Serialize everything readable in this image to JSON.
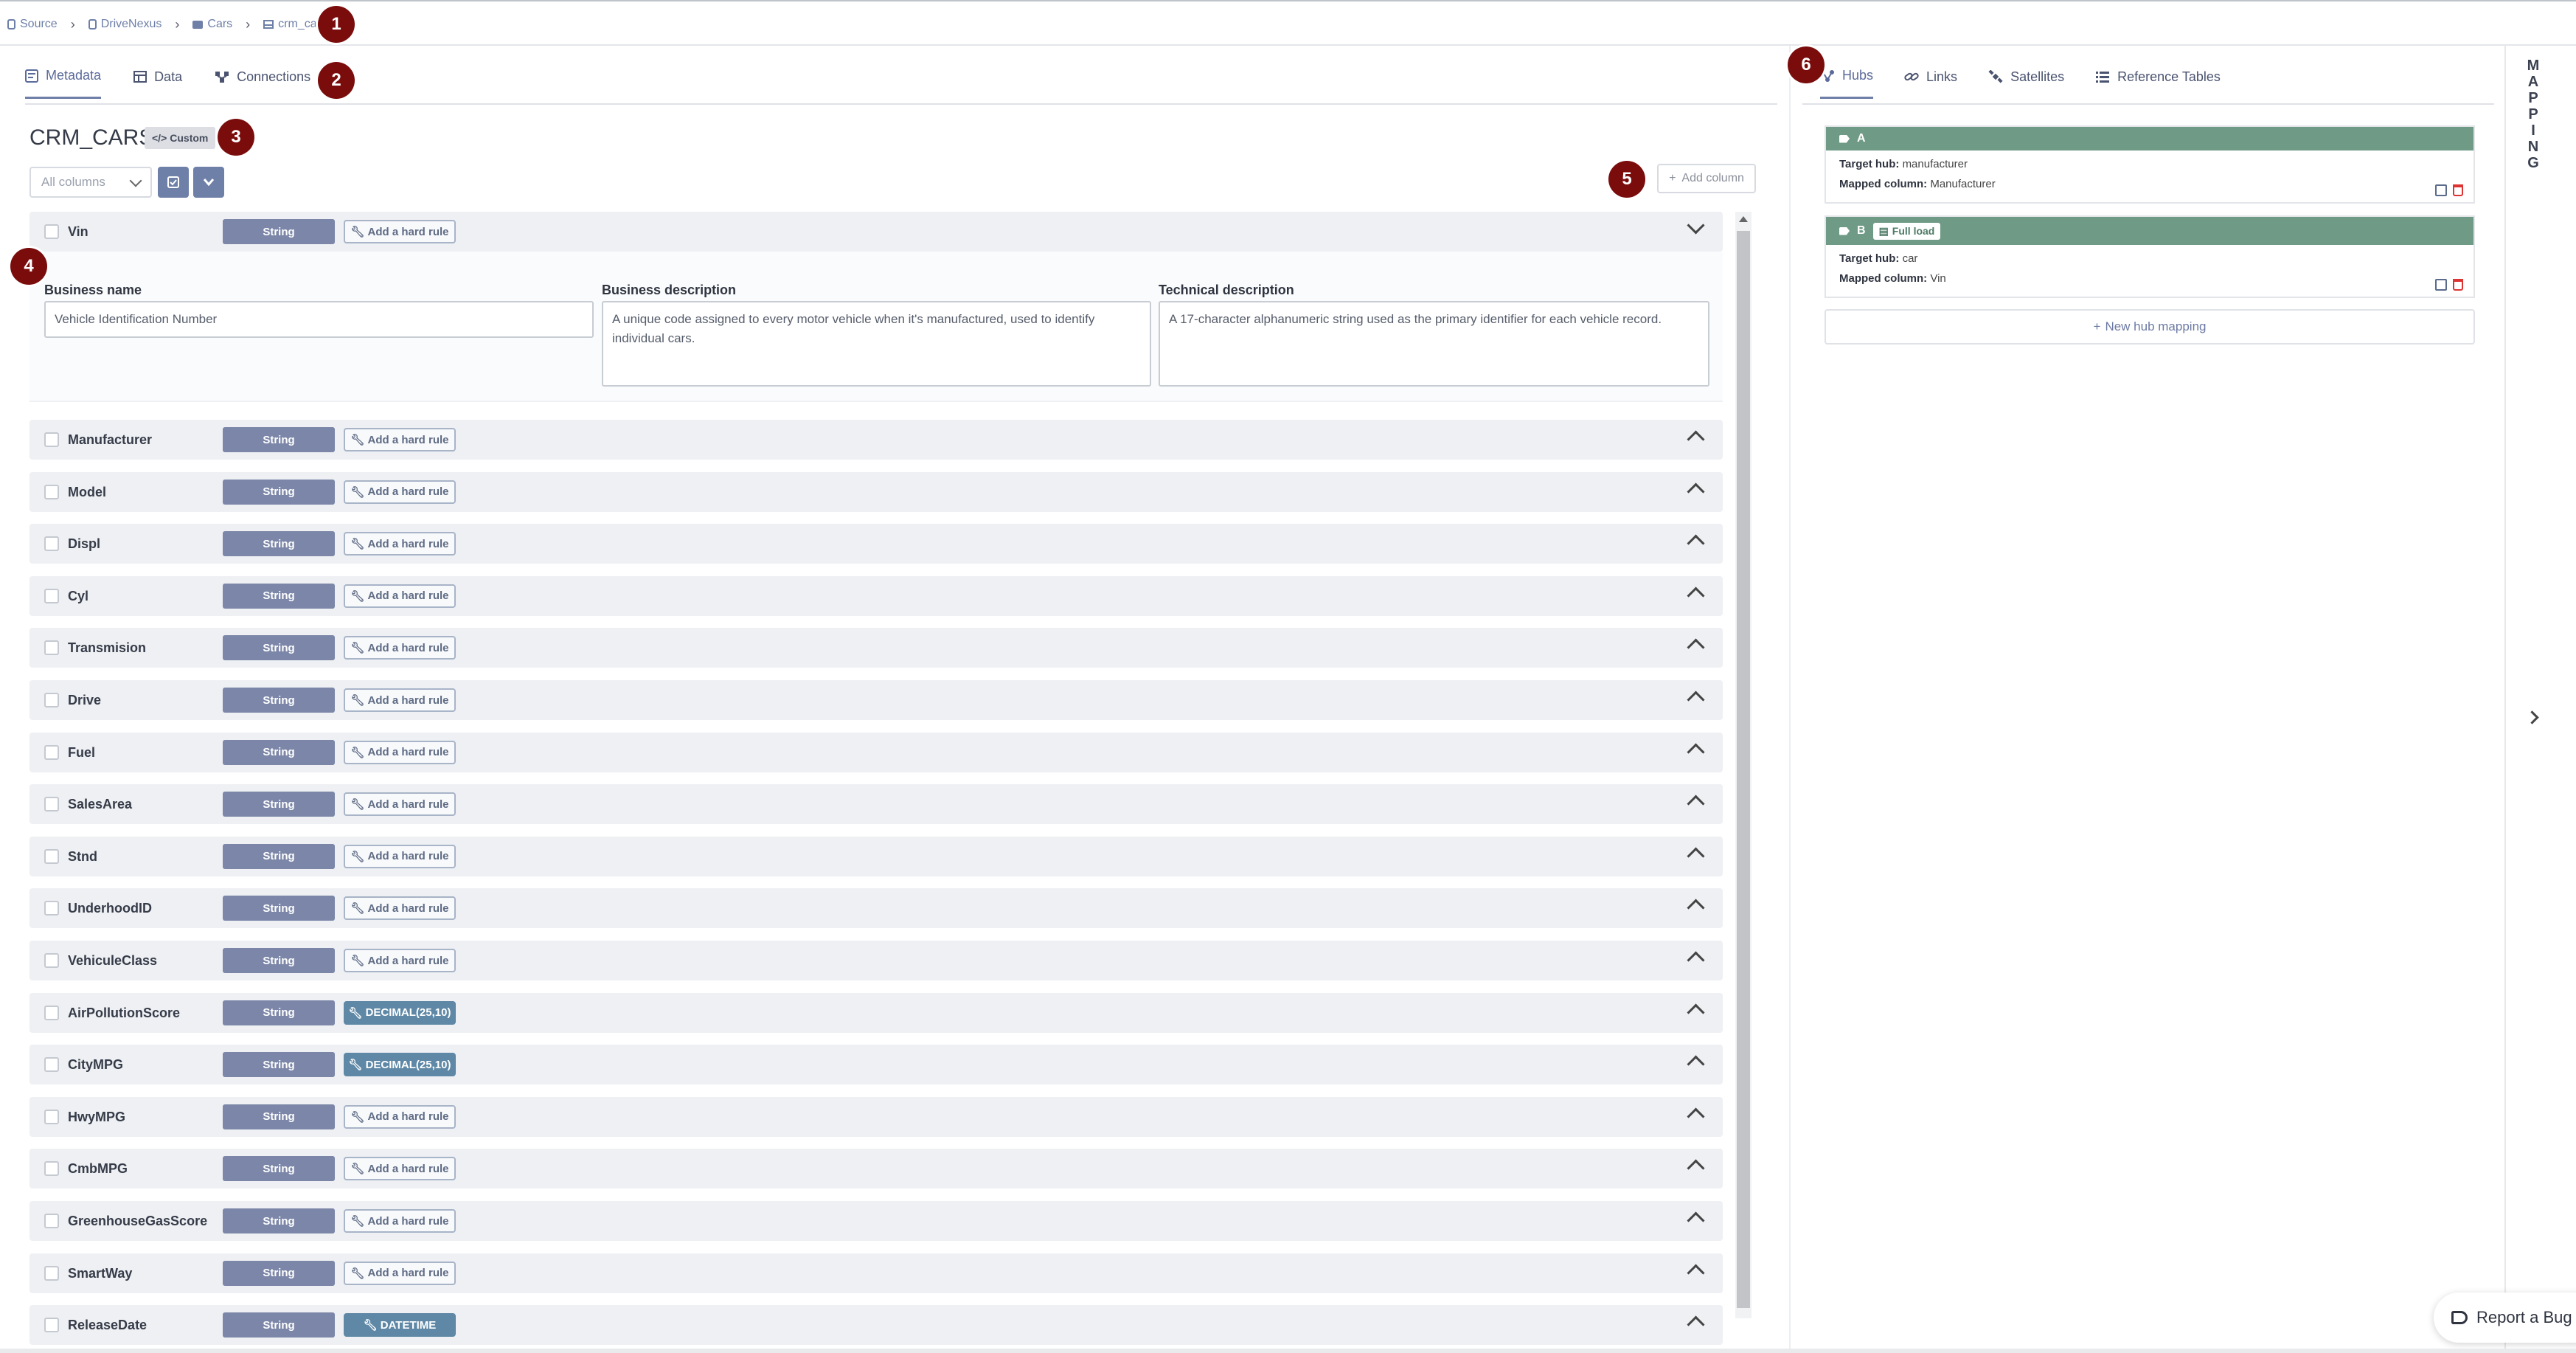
{
  "breadcrumb": [
    "Source",
    "DriveNexus",
    "Cars",
    "crm_cars"
  ],
  "badges": [
    "1",
    "2",
    "3",
    "4",
    "5",
    "6"
  ],
  "left_tabs": [
    {
      "label": "Metadata",
      "icon": "metadata-icon",
      "active": true
    },
    {
      "label": "Data",
      "icon": "table-icon",
      "active": false
    },
    {
      "label": "Connections",
      "icon": "connections-icon",
      "active": false
    }
  ],
  "table": {
    "title": "CRM_CARS",
    "tag": "Custom"
  },
  "filter": {
    "selected": "All columns"
  },
  "add_column_label": "Add column",
  "expanded_column": {
    "business_name_label": "Business name",
    "business_name_value": "Vehicle Identification Number",
    "business_description_label": "Business description",
    "business_description_value": "A unique code assigned to every motor vehicle when it's manufactured, used to identify individual cars.",
    "technical_description_label": "Technical description",
    "technical_description_value": "A 17-character alphanumeric string used as the primary identifier for each vehicle record."
  },
  "columns": [
    {
      "name": "Vin",
      "type": "String",
      "rule": "Add a hard rule",
      "rule_set": false,
      "expanded": true
    },
    {
      "name": "Manufacturer",
      "type": "String",
      "rule": "Add a hard rule",
      "rule_set": false
    },
    {
      "name": "Model",
      "type": "String",
      "rule": "Add a hard rule",
      "rule_set": false
    },
    {
      "name": "Displ",
      "type": "String",
      "rule": "Add a hard rule",
      "rule_set": false
    },
    {
      "name": "Cyl",
      "type": "String",
      "rule": "Add a hard rule",
      "rule_set": false
    },
    {
      "name": "Transmision",
      "type": "String",
      "rule": "Add a hard rule",
      "rule_set": false
    },
    {
      "name": "Drive",
      "type": "String",
      "rule": "Add a hard rule",
      "rule_set": false
    },
    {
      "name": "Fuel",
      "type": "String",
      "rule": "Add a hard rule",
      "rule_set": false
    },
    {
      "name": "SalesArea",
      "type": "String",
      "rule": "Add a hard rule",
      "rule_set": false
    },
    {
      "name": "Stnd",
      "type": "String",
      "rule": "Add a hard rule",
      "rule_set": false
    },
    {
      "name": "UnderhoodID",
      "type": "String",
      "rule": "Add a hard rule",
      "rule_set": false
    },
    {
      "name": "VehiculeClass",
      "type": "String",
      "rule": "Add a hard rule",
      "rule_set": false
    },
    {
      "name": "AirPollutionScore",
      "type": "String",
      "rule": "DECIMAL(25,10)",
      "rule_set": true
    },
    {
      "name": "CityMPG",
      "type": "String",
      "rule": "DECIMAL(25,10)",
      "rule_set": true
    },
    {
      "name": "HwyMPG",
      "type": "String",
      "rule": "Add a hard rule",
      "rule_set": false
    },
    {
      "name": "CmbMPG",
      "type": "String",
      "rule": "Add a hard rule",
      "rule_set": false
    },
    {
      "name": "GreenhouseGasScore",
      "type": "String",
      "rule": "Add a hard rule",
      "rule_set": false
    },
    {
      "name": "SmartWay",
      "type": "String",
      "rule": "Add a hard rule",
      "rule_set": false
    },
    {
      "name": "ReleaseDate",
      "type": "String",
      "rule": "DATETIME",
      "rule_set": true
    }
  ],
  "right_tabs": [
    {
      "label": "Hubs",
      "icon": "hubs-icon",
      "active": true
    },
    {
      "label": "Links",
      "icon": "link-icon",
      "active": false
    },
    {
      "label": "Satellites",
      "icon": "satellite-icon",
      "active": false
    },
    {
      "label": "Reference Tables",
      "icon": "list-icon",
      "active": false
    }
  ],
  "hubs": [
    {
      "name": "A",
      "tag": "",
      "target_label": "Target hub:",
      "target": "manufacturer",
      "mapped_label": "Mapped column:",
      "mapped": "Manufacturer"
    },
    {
      "name": "B",
      "tag": "Full load",
      "target_label": "Target hub:",
      "target": "car",
      "mapped_label": "Mapped column:",
      "mapped": "Vin"
    }
  ],
  "new_hub_label": "New hub mapping",
  "mapping_label": "MAPPING",
  "report_bug_label": "Report a Bug",
  "colors": {
    "accent": "#6e7fa8",
    "hub_header": "#6f9a86",
    "badge": "#7a0c0c",
    "rule_set": "#5e88a6"
  }
}
